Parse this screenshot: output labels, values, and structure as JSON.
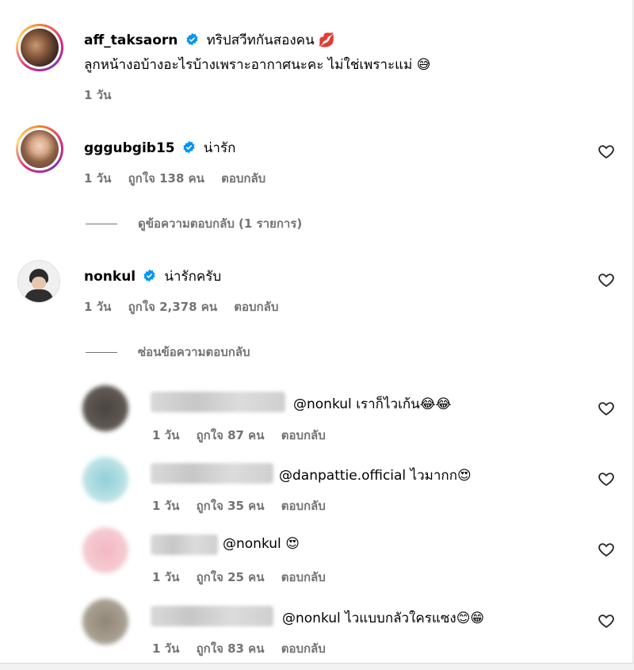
{
  "post_comment": {
    "username": "aff_taksaorn",
    "line1": "ทริปสวีทกันสองคน",
    "line1_emoji": "💋",
    "line2": "ลูกหน้างอบ้างอะไรบ้างเพราะอากาศนะคะ ไม่ใช่เพราะแม่",
    "line2_emoji": "😅",
    "time": "1 วัน"
  },
  "comments": [
    {
      "username": "gggubgib15",
      "text": "น่ารัก",
      "time": "1 วัน",
      "likes": "ถูกใจ 138 คน",
      "reply": "ตอบกลับ",
      "toggle": "ดูข้อความตอบกลับ (1 รายการ)"
    },
    {
      "username": "nonkul",
      "text": "น่ารักครับ",
      "time": "1 วัน",
      "likes": "ถูกใจ 2,378 คน",
      "reply": "ตอบกลับ",
      "toggle": "ซ่อนข้อความตอบกลับ"
    }
  ],
  "replies": [
    {
      "mention": "@nonkul",
      "text": "เราก็ไวเก้น",
      "emoji": "😂😂",
      "time": "1 วัน",
      "likes": "ถูกใจ 87 คน",
      "reply": "ตอบกลับ"
    },
    {
      "mention": "@danpattie.official",
      "text": "ไวมากก",
      "emoji": "😍",
      "time": "1 วัน",
      "likes": "ถูกใจ 35 คน",
      "reply": "ตอบกลับ"
    },
    {
      "mention": "@nonkul",
      "text": "",
      "emoji": "😍",
      "time": "1 วัน",
      "likes": "ถูกใจ 25 คน",
      "reply": "ตอบกลับ"
    },
    {
      "mention": "@nonkul",
      "text": "ไวแบบกลัวใครแซง",
      "emoji": "😊😁",
      "time": "1 วัน",
      "likes": "ถูกใจ 83 คน",
      "reply": "ตอบกลับ"
    }
  ],
  "icons": {
    "like": "heart-outline-icon",
    "verified": "verified-badge-icon"
  },
  "colors": {
    "verified": "#0095f6",
    "muted": "#737373"
  }
}
